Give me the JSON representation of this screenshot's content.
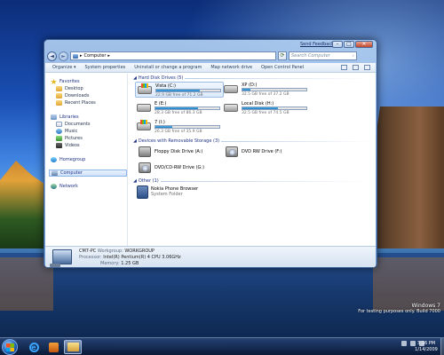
{
  "window": {
    "send_feedback": "Send Feedback",
    "controls": {
      "minimize": "–",
      "maximize": "□",
      "close": "✕"
    }
  },
  "address_bar": {
    "path": "Computer",
    "separator": "▸",
    "search_placeholder": "Search Computer",
    "search_icon": "⌕"
  },
  "toolbar": {
    "organize": "Organize ▾",
    "system_properties": "System properties",
    "uninstall": "Uninstall or change a program",
    "map_network": "Map network drive",
    "control_panel": "Open Control Panel"
  },
  "nav": {
    "favorites": "Favorites",
    "desktop": "Desktop",
    "downloads": "Downloads",
    "recent": "Recent Places",
    "libraries": "Libraries",
    "documents": "Documents",
    "music": "Music",
    "pictures": "Pictures",
    "videos": "Videos",
    "homegroup": "Homegroup",
    "computer": "Computer",
    "network": "Network"
  },
  "groups": {
    "hdd": "Hard Disk Drives (5)",
    "removable": "Devices with Removable Storage (3)",
    "other": "Other (1)"
  },
  "drives": [
    {
      "name": "Vista (C:)",
      "free": "22.9 GB free of 71.2 GB",
      "used_fraction": 0.68
    },
    {
      "name": "XP (D:)",
      "free": "32.5 GB free of 37.2 GB",
      "used_fraction": 0.13
    },
    {
      "name": "E (E:)",
      "free": "28.3 GB free of 86.3 GB",
      "used_fraction": 0.67
    },
    {
      "name": "Local Disk (H:)",
      "free": "32.5 GB free of 74.5 GB",
      "used_fraction": 0.56
    },
    {
      "name": "7 (I:)",
      "free": "26.3 GB free of 35.9 GB",
      "used_fraction": 0.27
    }
  ],
  "removable": [
    {
      "name": "Floppy Disk Drive (A:)"
    },
    {
      "name": "DVD RW Drive (F:)"
    },
    {
      "name": "DVD/CD-RW Drive (G:)"
    }
  ],
  "other": {
    "name": "Nokia Phone Browser",
    "sub": "System Folder"
  },
  "details": {
    "computer_name": "CM7-PC",
    "workgroup_label": "Workgroup:",
    "workgroup": "WORKGROUP",
    "processor_label": "Processor:",
    "processor": "Intel(R) Pentium(R) 4 CPU 3.06GHz",
    "memory_label": "Memory:",
    "memory": "1.25 GB"
  },
  "watermark": {
    "os": "Windows 7",
    "line": "For testing purposes only. Build 7000"
  },
  "clock": {
    "time": "3:16 PM",
    "date": "1/14/2009"
  }
}
